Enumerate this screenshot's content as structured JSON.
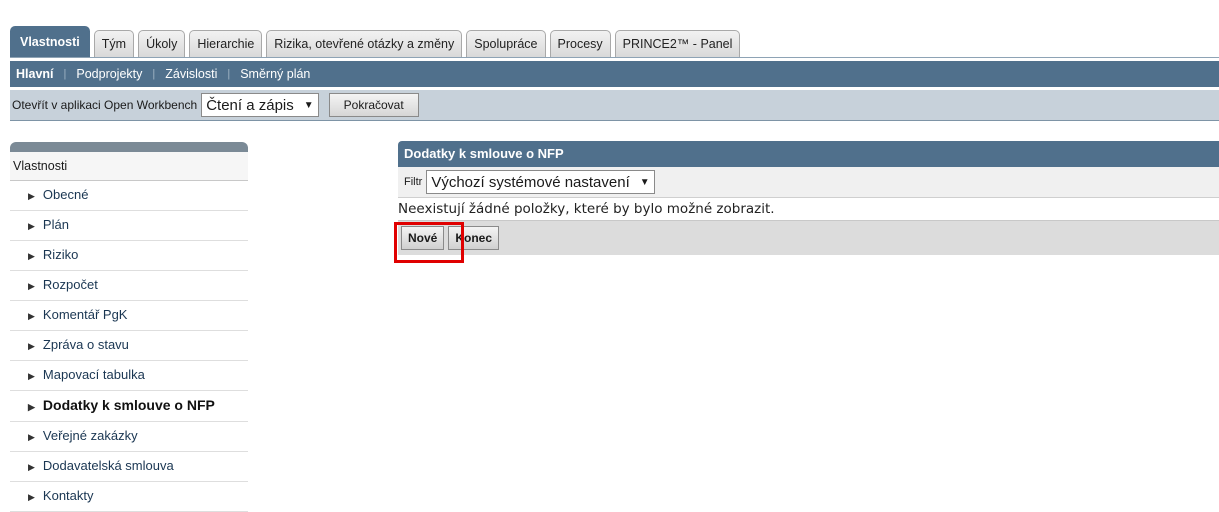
{
  "tabs": [
    {
      "label": "Vlastnosti",
      "active": true
    },
    {
      "label": "Tým"
    },
    {
      "label": "Úkoly"
    },
    {
      "label": "Hierarchie"
    },
    {
      "label": "Rizika, otevřené otázky a změny"
    },
    {
      "label": "Spolupráce"
    },
    {
      "label": "Procesy"
    },
    {
      "label": "PRINCE2™ - Panel"
    }
  ],
  "subnav": [
    "Hlavní",
    "Podprojekty",
    "Závislosti",
    "Směrný plán"
  ],
  "toolbar": {
    "label": "Otevřít v aplikaci Open Workbench",
    "select_value": "Čtení a zápis",
    "button": "Pokračovat"
  },
  "sidebar": {
    "title": "Vlastnosti",
    "items": [
      "Obecné",
      "Plán",
      "Riziko",
      "Rozpočet",
      "Komentář PgK",
      "Zpráva o stavu",
      "Mapovací tabulka",
      "Dodatky k smlouve o NFP",
      "Veřejné zakázky",
      "Dodavatelská smlouva",
      "Kontakty"
    ]
  },
  "panel": {
    "title": "Dodatky k smlouve o NFP",
    "filter_label": "Filtr",
    "filter_value": "Výchozí systémové nastavení",
    "empty_text": "Neexistují žádné položky, které by bylo možné zobrazit.",
    "new_button": "Nové",
    "close_button": "Konec"
  },
  "colors": {
    "header_blue": "#50708c",
    "toolbar_bg": "#c7d1da",
    "highlight_red": "#e00000"
  }
}
